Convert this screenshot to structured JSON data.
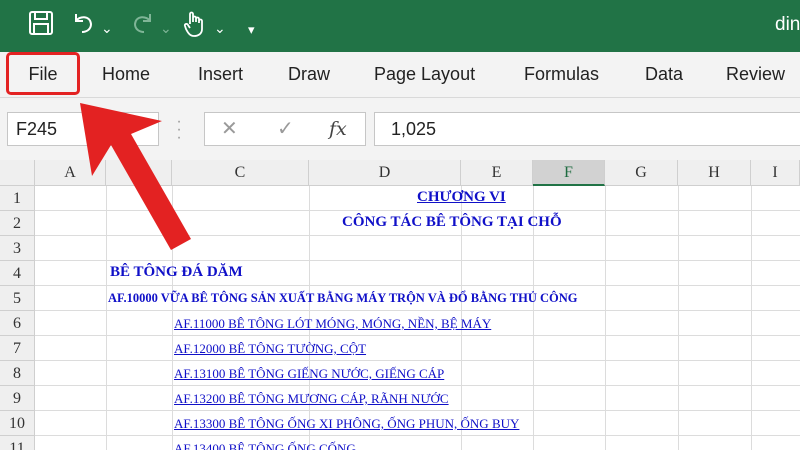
{
  "titlebar": {
    "title": "din",
    "icons": [
      "save-icon",
      "undo-icon",
      "redo-icon",
      "touch-mode-icon",
      "customize-quick-access-icon"
    ]
  },
  "ribbon": {
    "tabs": [
      "File",
      "Home",
      "Insert",
      "Draw",
      "Page Layout",
      "Formulas",
      "Data",
      "Review"
    ]
  },
  "formula_bar": {
    "name_box": "F245",
    "cancel": "✕",
    "enter": "✓",
    "fx": "fx",
    "value": "1,025"
  },
  "grid": {
    "columns": [
      "A",
      "B",
      "C",
      "D",
      "E",
      "F",
      "G",
      "H",
      "I"
    ],
    "selected_column": "F",
    "rows": [
      "1",
      "2",
      "3",
      "4",
      "5",
      "6",
      "7",
      "8",
      "9",
      "10",
      "11"
    ],
    "cells": {
      "r1": "CHƯƠNG VI",
      "r2": "CÔNG TÁC BÊ TÔNG TẠI  CHỖ",
      "r4": "BÊ TÔNG ĐÁ DĂM",
      "r5": "AF.10000  VỮA BÊ TÔNG SẢN XUẤT BẰNG MÁY TRỘN VÀ ĐỔ BẰNG THỦ CÔNG",
      "r6": "AF.11000 BÊ TÔNG LÓT MÓNG, MÓNG, NỀN, BỆ MÁY",
      "r7": "AF.12000 BÊ TÔNG TƯỜNG, CỘT",
      "r8": "AF.13100 BÊ TÔNG GIẾNG NƯỚC, GIẾNG CÁP",
      "r9": "AF.13200 BÊ TÔNG MƯƠNG CÁP, RÃNH NƯỚC",
      "r10": "AF.13300 BÊ TÔNG ỐNG XI PHÔNG, ỐNG PHUN, ỐNG BUY",
      "r11": "AF.13400 BÊ TÔNG ỐNG CỐNG"
    },
    "text_color": "#1010c8"
  },
  "annotation": {
    "color": "#e32222",
    "shape": "arrow pointing to File tab"
  },
  "colors": {
    "accent": "#217346",
    "highlight": "#e32222"
  }
}
